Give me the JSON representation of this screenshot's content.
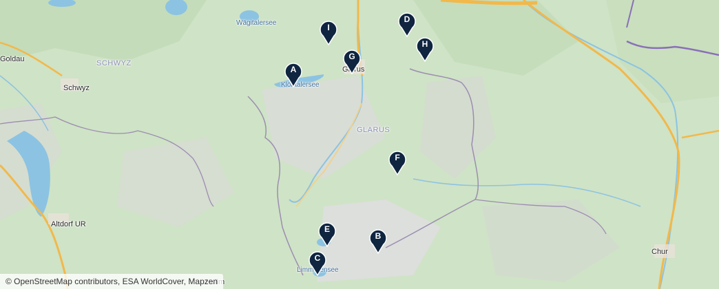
{
  "map": {
    "labels": {
      "goldau": "Goldau",
      "schwyz_region": "SCHWYZ",
      "schwyz": "Schwyz",
      "waegitalersee": "Wägitalersee",
      "kloentalersee": "Klöntalersee",
      "glarus_town": "Glarus",
      "glarus_region": "GLARUS",
      "altdorf": "Altdorf UR",
      "limmerensee": "Limmerensee",
      "chur": "Chur",
      "hullm": "Hullm"
    },
    "markers": [
      "A",
      "B",
      "C",
      "D",
      "E",
      "F",
      "G",
      "H",
      "I"
    ],
    "marker_color": "#0f2540"
  },
  "attribution": "© OpenStreetMap contributors, ESA WorldCover, Mapzen"
}
